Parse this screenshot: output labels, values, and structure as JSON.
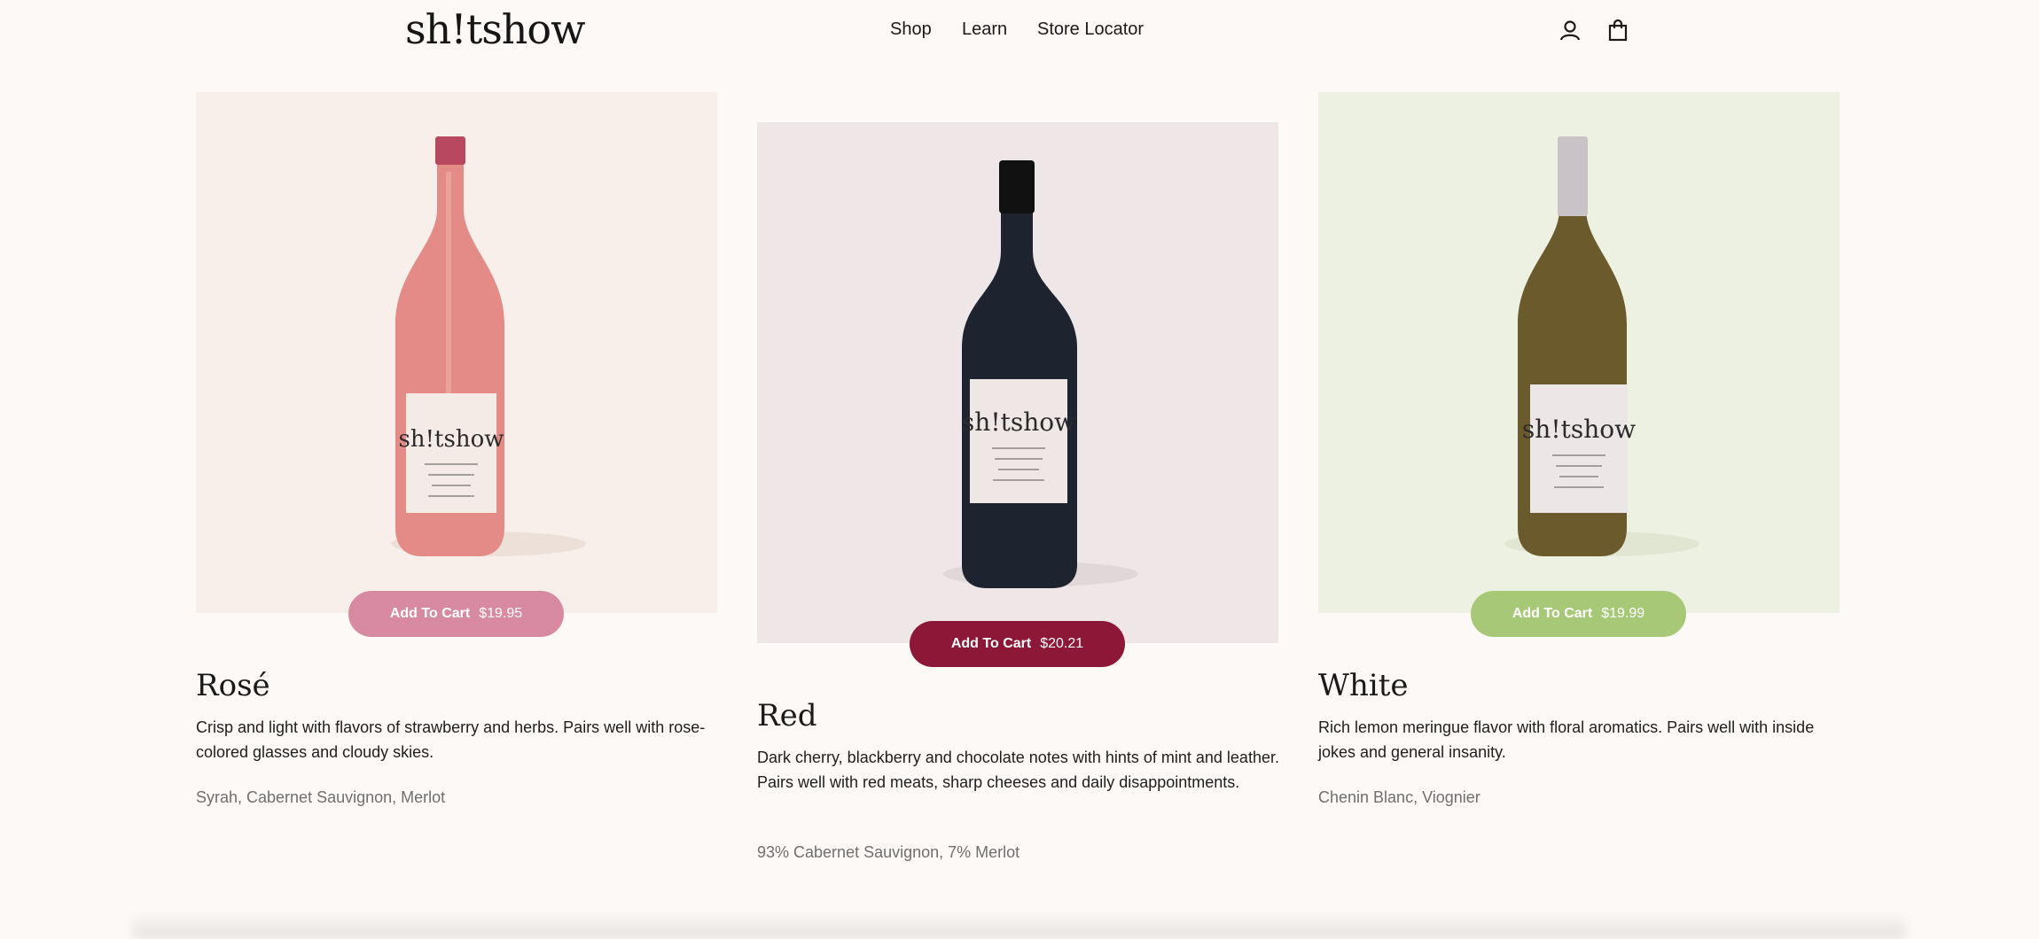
{
  "header": {
    "logo": "sh!tshow",
    "nav": [
      "Shop",
      "Learn",
      "Store Locator"
    ],
    "account_icon": "account-icon",
    "cart_icon": "shopping-bag-icon"
  },
  "products": [
    {
      "name": "Rosé",
      "button_label": "Add To Cart",
      "price": "$19.95",
      "description": "Crisp and light with flavors of strawberry and herbs. Pairs well with rose-colored glasses and cloudy skies.",
      "varietals": "Syrah, Cabernet Sauvignon, Merlot",
      "label_text": "sh!tshow",
      "accent": "#d98aa3",
      "bg": "#f8efea",
      "wine": "#e48a87"
    },
    {
      "name": "Red",
      "button_label": "Add To Cart",
      "price": "$20.21",
      "description": "Dark cherry, blackberry and chocolate notes with hints of mint and leather. Pairs well with red meats, sharp cheeses and daily disappointments.",
      "varietals": "93% Cabernet Sauvignon, 7% Merlot",
      "label_text": "sh!tshow",
      "accent": "#8c1736",
      "bg": "#efe6e7",
      "wine": "#1e2330"
    },
    {
      "name": "White",
      "button_label": "Add To Cart",
      "price": "$19.99",
      "description": "Rich lemon meringue flavor with floral aromatics. Pairs well with inside jokes and general insanity.",
      "varietals": "Chenin Blanc, Viognier",
      "label_text": "sh!tshow",
      "accent": "#a7c977",
      "bg": "#edf1e2",
      "wine": "#6b5a2c"
    }
  ]
}
